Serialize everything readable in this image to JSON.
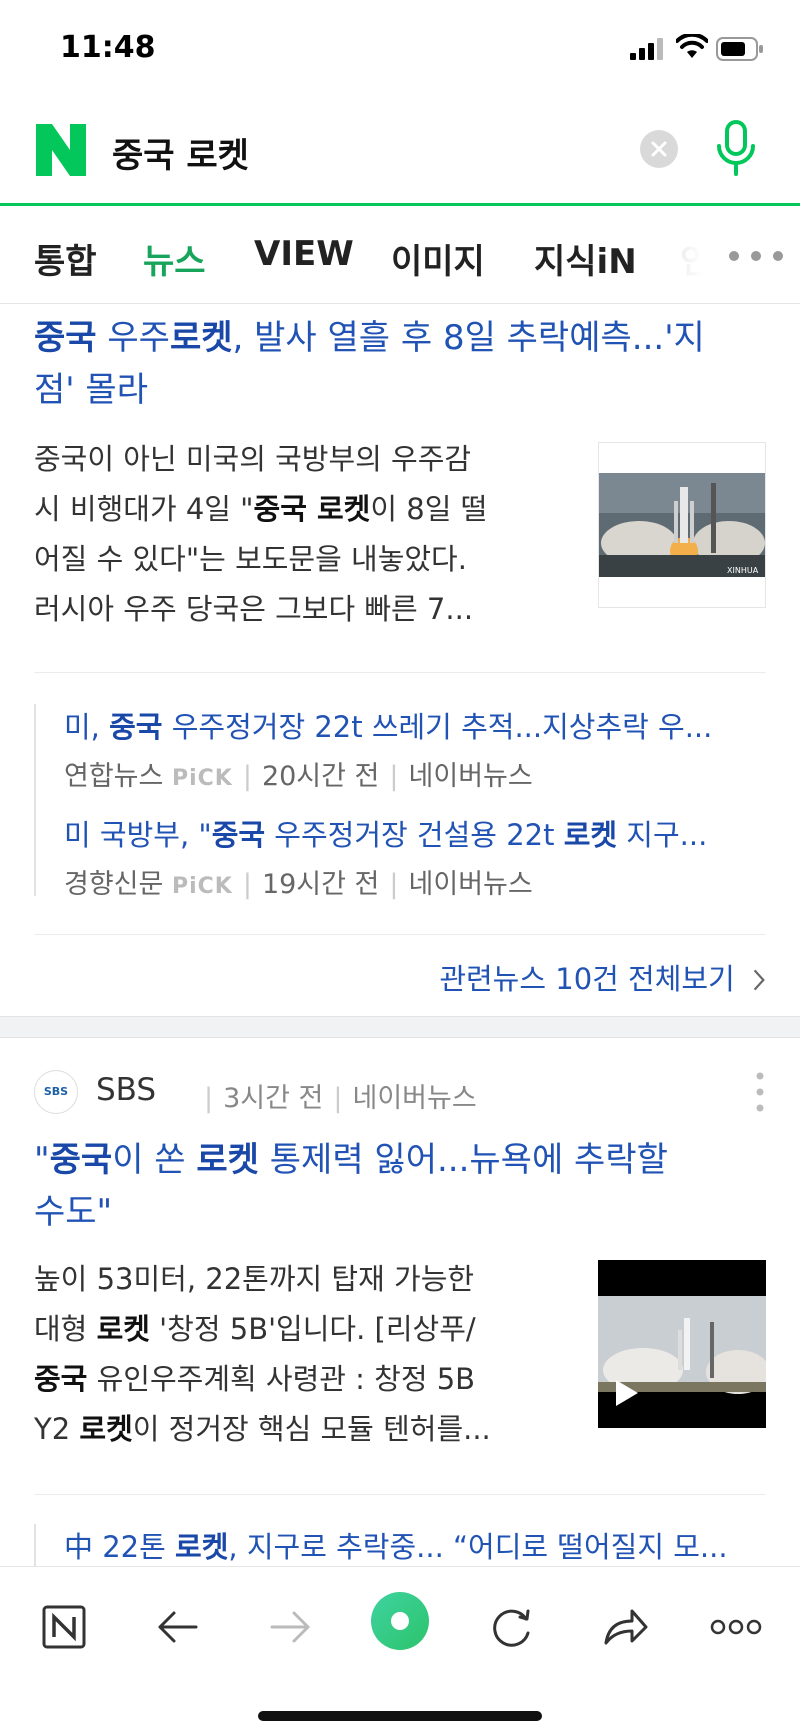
{
  "status_bar": {
    "time": "11:48"
  },
  "search": {
    "query": "중국 로켓"
  },
  "tabs": [
    {
      "label": "통합"
    },
    {
      "label": "뉴스"
    },
    {
      "label": "VIEW"
    },
    {
      "label": "이미지"
    },
    {
      "label": "지식iN"
    },
    {
      "label": "인"
    }
  ],
  "article1": {
    "title_parts": [
      "중국",
      " 우주",
      "로켓",
      ", 발사 열흘 후 8일 추락예측...'지",
      "점' 몰라"
    ],
    "desc_parts": [
      "중국이 아닌 미국의 국방부의 우주감",
      "시 비행대가 4일 \"",
      "중국 로켓",
      "이 8일 떨",
      "어질 수 있다\"는 보도문을 내놓았다.",
      "러시아 우주 당국은 그보다 빠른 7..."
    ],
    "thumb_caption": "XINHUA",
    "related": [
      {
        "title_parts": [
          "미, ",
          "중국",
          " 우주정거장 22t 쓰레기 추적...지상추락 우..."
        ],
        "press": "연합뉴스",
        "pick": "PiCK",
        "time": "20시간 전",
        "platform": "네이버뉴스"
      },
      {
        "title_parts": [
          "미 국방부, \"",
          "중국",
          " 우주정거장 건설용 22t ",
          "로켓",
          " 지구..."
        ],
        "press": "경향신문",
        "pick": "PiCK",
        "time": "19시간 전",
        "platform": "네이버뉴스"
      }
    ],
    "all_news": "관련뉴스 10건 전체보기"
  },
  "article2": {
    "source": {
      "logo": "SBS",
      "name": "SBS",
      "time": "3시간 전",
      "platform": "네이버뉴스"
    },
    "title_parts": [
      "\"",
      "중국",
      "이 쏜 ",
      "로켓",
      " 통제력 잃어...뉴욕에 추락할",
      "수도\""
    ],
    "desc_parts": [
      "높이 53미터, 22톤까지 탑재 가능한",
      "대형 ",
      "로켓",
      " '창정 5B'입니다. [리상푸/",
      "중국",
      " 유인우주계획 사령관 : 창정 5B",
      "Y2 ",
      "로켓",
      "이 정거장 핵심 모듈 텐허를..."
    ],
    "related_partial": [
      "中 22톤 ",
      "로켓",
      ", 지구로 추락중... “어디로 떨어질지 모..."
    ]
  },
  "colors": {
    "brand_green": "#03c75a",
    "link_blue": "#2153b5",
    "tab_active": "#19a45c"
  },
  "icons": [
    "naver-n-logo-icon",
    "clear-icon",
    "mic-icon",
    "more-icon",
    "chevron-right-icon",
    "kebab-icon",
    "play-icon",
    "naver-home-icon",
    "back-icon",
    "forward-icon",
    "green-dot-icon",
    "reload-icon",
    "share-icon",
    "more-options-icon"
  ]
}
